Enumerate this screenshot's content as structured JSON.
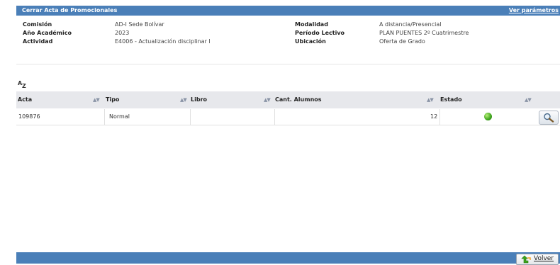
{
  "window": {
    "title": "Cerrar Acta de Promocionales",
    "params_link": "Ver parámetros"
  },
  "info": {
    "left": [
      {
        "label": "Comisión",
        "value": "AD-I Sede Bolívar"
      },
      {
        "label": "Año Académico",
        "value": "2023"
      },
      {
        "label": "Actividad",
        "value": "E4006 - Actualización disciplinar I"
      }
    ],
    "right": [
      {
        "label": "Modalidad",
        "value": "A distancia/Presencial"
      },
      {
        "label": "Período Lectivo",
        "value": "PLAN PUENTES 2º Cuatrimestre"
      },
      {
        "label": "Ubicación",
        "value": "Oferta de Grado"
      }
    ]
  },
  "sort_icon": {
    "letter_top": "A",
    "letter_bottom": "Z"
  },
  "table": {
    "columns": [
      "Acta",
      "Tipo",
      "Libro",
      "Cant. Alumnos",
      "Estado"
    ],
    "sort_glyph": "▲▼",
    "rows": [
      {
        "acta": "109876",
        "tipo": "Normal",
        "libro": "",
        "cant_alumnos": "12",
        "estado": "green-status-dot"
      }
    ]
  },
  "footer": {
    "back_label": "Volver"
  },
  "icons": {
    "status": "green-status-dot",
    "view": "magnifier-icon",
    "back": "green-back-arrow-icon",
    "sort": "az-sort-icon"
  },
  "colors": {
    "header_bar": "#4a7fb8",
    "grid_header": "#e7e8ec",
    "status_ok": "#3ca31c"
  }
}
